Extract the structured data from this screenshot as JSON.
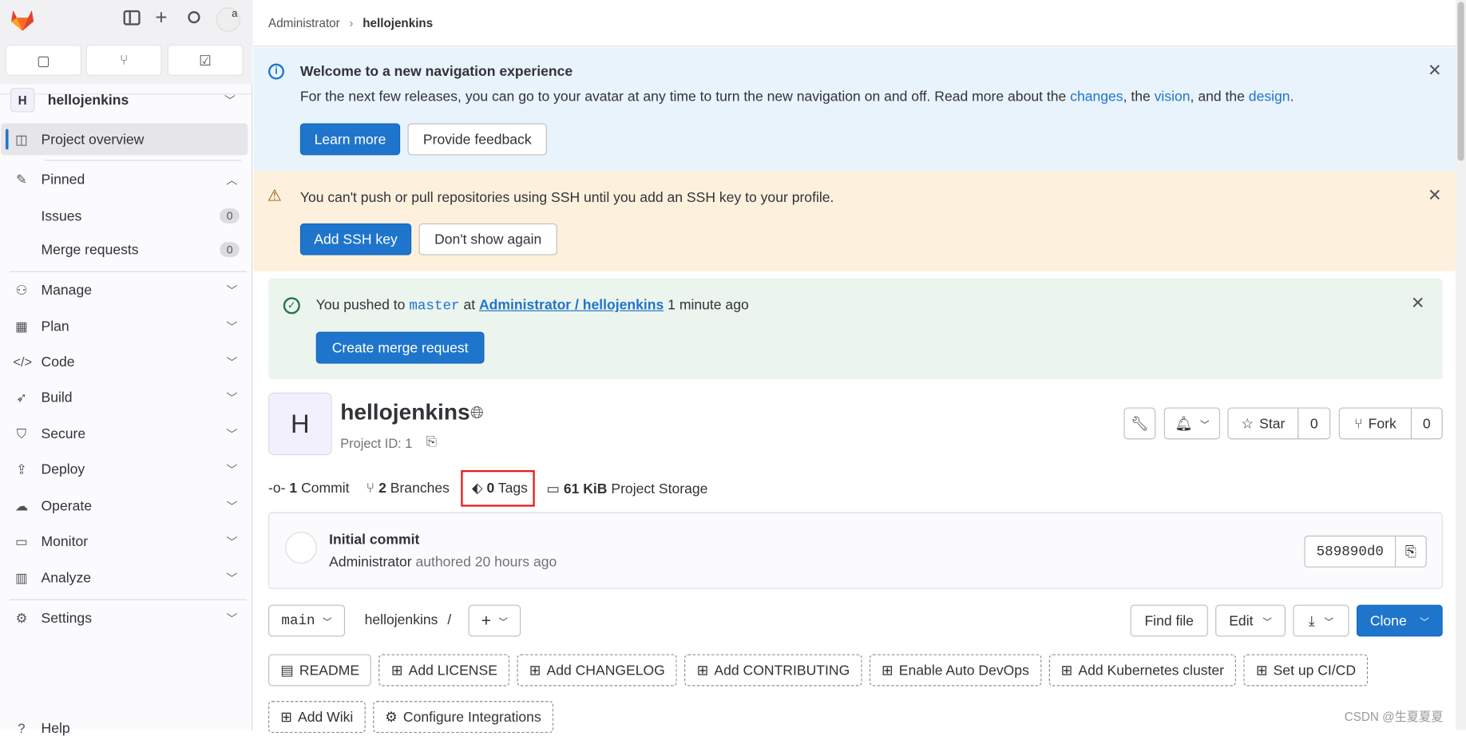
{
  "sidebar": {
    "project_initial": "H",
    "project_name": "hellojenkins",
    "active_item": "Project overview",
    "pinned": {
      "label": "Pinned",
      "items": [
        {
          "label": "Issues",
          "count": "0"
        },
        {
          "label": "Merge requests",
          "count": "0"
        }
      ]
    },
    "groups": [
      "Manage",
      "Plan",
      "Code",
      "Build",
      "Secure",
      "Deploy",
      "Operate",
      "Monitor",
      "Analyze"
    ],
    "settings": "Settings",
    "help": "Help",
    "avatar_alt": "a"
  },
  "breadcrumb": {
    "parent": "Administrator",
    "current": "hellojenkins"
  },
  "nav_banner": {
    "title": "Welcome to a new navigation experience",
    "text": "For the next few releases, you can go to your avatar at any time to turn the new navigation on and off. Read more about the",
    "link1": "changes",
    "sep1": ", the",
    "link2": "vision",
    "sep2": ", and the",
    "link3": "design",
    "end": ".",
    "learn_more": "Learn more",
    "feedback": "Provide feedback"
  },
  "ssh_banner": {
    "text": "You can't push or pull repositories using SSH until you add an SSH key to your profile.",
    "add": "Add SSH key",
    "dismiss": "Don't show again"
  },
  "push_alert": {
    "pre": "You pushed to",
    "branch": "master",
    "at": "at",
    "project": "Administrator / hellojenkins",
    "time": "1 minute ago",
    "button": "Create merge request"
  },
  "project": {
    "initial": "H",
    "name": "hellojenkins",
    "id_label": "Project ID: 1",
    "star": "Star",
    "star_count": "0",
    "fork": "Fork",
    "fork_count": "0"
  },
  "stats": {
    "commits_n": "1",
    "commits": "Commit",
    "branches_n": "2",
    "branches": "Branches",
    "tags_n": "0",
    "tags": "Tags",
    "storage_n": "61 KiB",
    "storage": "Project Storage"
  },
  "commit": {
    "title": "Initial commit",
    "author": "Administrator",
    "meta": "authored 20 hours ago",
    "sha": "589890d0"
  },
  "toolbar": {
    "branch": "main",
    "path": "hellojenkins",
    "slash": "/",
    "find": "Find file",
    "edit": "Edit",
    "clone": "Clone"
  },
  "suggestions": [
    "README",
    "Add LICENSE",
    "Add CHANGELOG",
    "Add CONTRIBUTING",
    "Enable Auto DevOps",
    "Add Kubernetes cluster",
    "Set up CI/CD",
    "Add Wiki",
    "Configure Integrations"
  ],
  "watermark": "CSDN @生夏夏夏",
  "colors": {
    "primary": "#1f75cb",
    "info_bg": "#e9f3fc",
    "warning_bg": "#fdf1dd",
    "success_bg": "#ecf4ee",
    "highlight": "#e02020"
  }
}
